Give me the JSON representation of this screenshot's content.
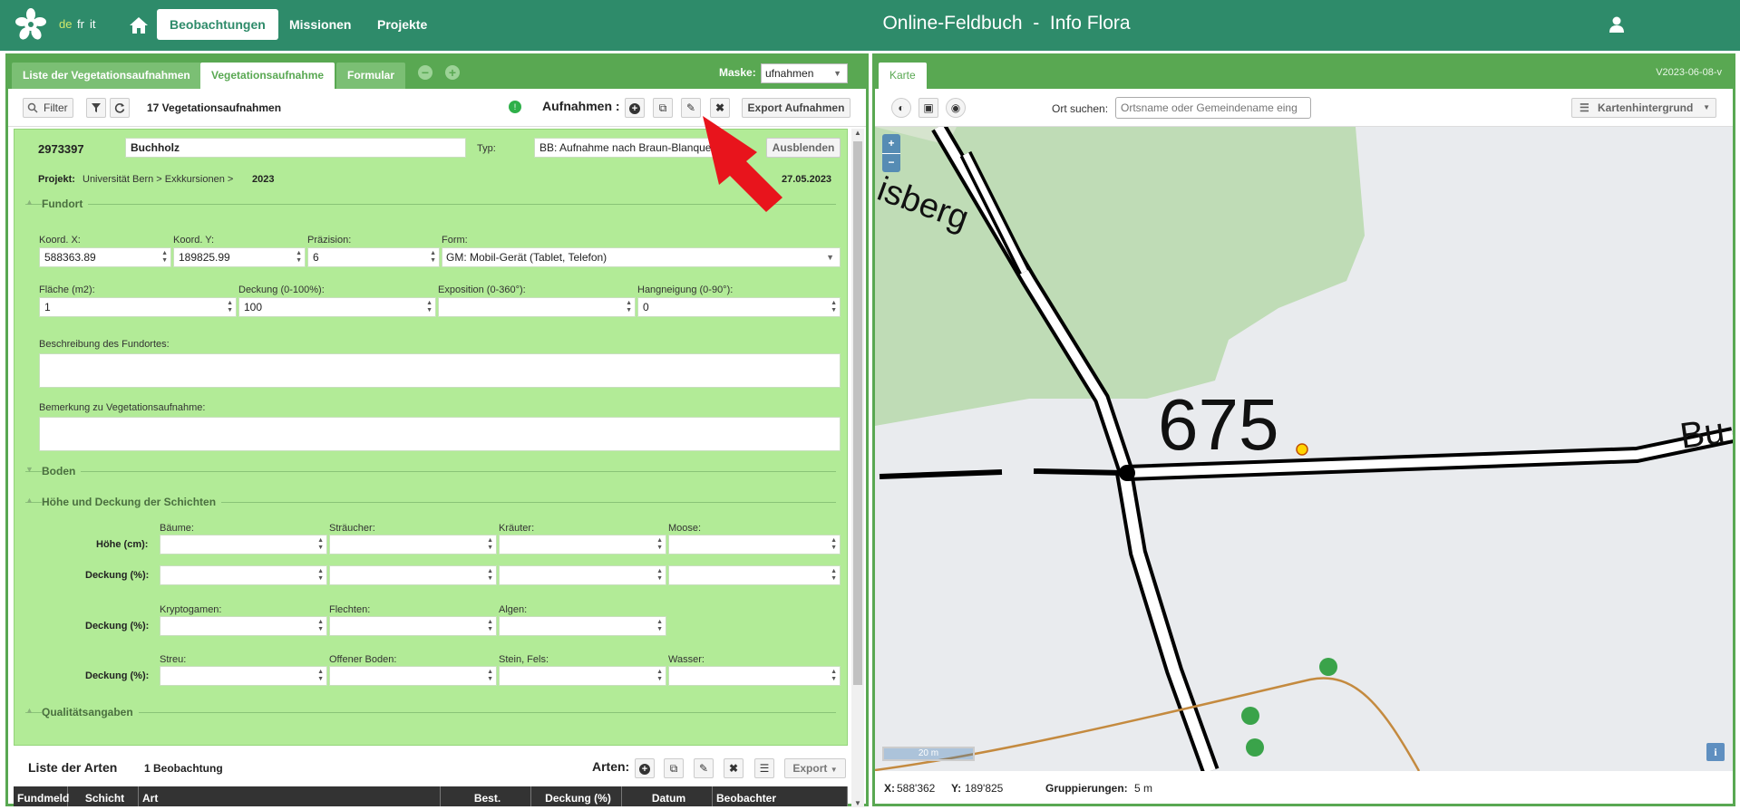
{
  "header": {
    "lang_de": "de",
    "lang_fr": "fr",
    "lang_it": "it",
    "nav": [
      "Beobachtungen",
      "Missionen",
      "Projekte"
    ],
    "title": "Online-Feldbuch  -  Info Flora"
  },
  "left": {
    "tabs": [
      "Liste der Vegetationsaufnahmen",
      "Vegetationsaufnahme",
      "Formular"
    ],
    "maske_label": "Maske:",
    "maske_value": "ufnahmen",
    "toolbar": {
      "filter": "Filter",
      "count": "17 Vegetationsaufnahmen",
      "aufnahmen_label": "Aufnahmen :",
      "export": "Export Aufnahmen"
    },
    "record": {
      "id": "2973397",
      "name": "Buchholz",
      "typ_label": "Typ:",
      "typ_value": "BB: Aufnahme nach Braun-Blanquet",
      "hide_button": "Ausblenden",
      "projekt_label": "Projekt:",
      "projekt_value": "Universität Bern > Exkkursionen >",
      "projekt_year": "2023",
      "date": "27.05.2023"
    },
    "fundort": {
      "title": "Fundort",
      "koordx_label": "Koord. X:",
      "koordx": "588363.89",
      "koordy_label": "Koord. Y:",
      "koordy": "189825.99",
      "praezision_label": "Präzision:",
      "praezision": "6",
      "form_label": "Form:",
      "form_value": "GM: Mobil-Gerät (Tablet, Telefon)",
      "flaeche_label": "Fläche (m2):",
      "flaeche": "1",
      "deckung_label": "Deckung (0-100%):",
      "deckung": "100",
      "exposition_label": "Exposition (0-360°):",
      "exposition": "",
      "hang_label": "Hangneigung (0-90°):",
      "hang": "0",
      "beschreibung_label": "Beschreibung des Fundortes:",
      "bemerkung_label": "Bemerkung zu Vegetationsaufnahme:"
    },
    "boden_title": "Boden",
    "schichten": {
      "title": "Höhe und Deckung der Schichten",
      "col1": [
        "Bäume:",
        "Sträucher:",
        "Kräuter:",
        "Moose:"
      ],
      "hoehe_label": "Höhe (cm):",
      "deckung_label": "Deckung (%):",
      "col2": [
        "Kryptogamen:",
        "Flechten:",
        "Algen:"
      ],
      "col3": [
        "Streu:",
        "Offener Boden:",
        "Stein, Fels:",
        "Wasser:"
      ]
    },
    "quality_title": "Qualitätsangaben",
    "species": {
      "title": "Liste der Arten",
      "count": "1 Beobachtung",
      "arten_label": "Arten:",
      "export": "Export",
      "columns": [
        "Fundmeld",
        "Schicht",
        "Art",
        "Best.",
        "Deckung (%)",
        "Datum",
        "Beobachter"
      ]
    }
  },
  "right": {
    "tab": "Karte",
    "version": "V2023-06-08-v",
    "search_label": "Ort suchen:",
    "search_placeholder": "Ortsname oder Gemeindename eing",
    "background_button": "Kartenhintergrund",
    "map": {
      "zoom_in": "+",
      "zoom_out": "−",
      "labels": [
        "isberg",
        "675",
        "Bu"
      ],
      "scale": "20 m",
      "info": "i"
    },
    "status": {
      "x_label": "X:",
      "x": "588'362",
      "y_label": "Y:",
      "y": "189'825",
      "group_label": "Gruppierungen:",
      "group": "5 m"
    }
  },
  "colors": {
    "topbar": "#2e8b6a",
    "panel_border": "#59a852",
    "form_bg": "#b2eb97",
    "arrow": "#e8141c"
  }
}
